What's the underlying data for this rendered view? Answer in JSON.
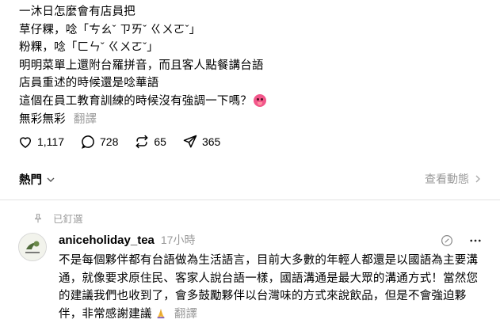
{
  "post": {
    "lines": [
      "一沐日怎麼會有店員把",
      "草仔粿，唸「ㄘㄠˇ ㄗㄞˇ ㄍㄨㄛˇ」",
      "粉粿，唸「ㄈㄣˇ ㄍㄨㄛˇ」",
      "明明菜單上還附台羅拼音，而且客人點餐講台語",
      "店員重述的時候還是唸華語",
      "這個在員工教育訓練的時候沒有強調一下嗎？"
    ],
    "last_line": "無彩無彩",
    "translate_label": "翻譯"
  },
  "actions": {
    "likes": "1,117",
    "replies": "728",
    "reposts": "65",
    "shares": "365"
  },
  "sort": {
    "label": "熱門"
  },
  "activity": {
    "label": "查看動態"
  },
  "pinned": {
    "label": "已釘選"
  },
  "comment": {
    "username": "aniceholiday_tea",
    "time": "17小時",
    "lines": [
      "不是每個夥伴都有台語做為生活語言，目前大多數的年輕人都還是以國語為主要溝",
      "通，就像要求原住民、客家人說台語一樣，國語溝通是最大眾的溝通方式！當然您",
      "的建議我們也收到了，會多鼓勵夥伴以台灣味的方式來說飲品，但是不會強迫夥"
    ],
    "last_line": "伴，非常感謝建議",
    "translate_label": "翻譯"
  },
  "colors": {
    "muted": "#999999",
    "accent_emoji": "#f2568a"
  }
}
